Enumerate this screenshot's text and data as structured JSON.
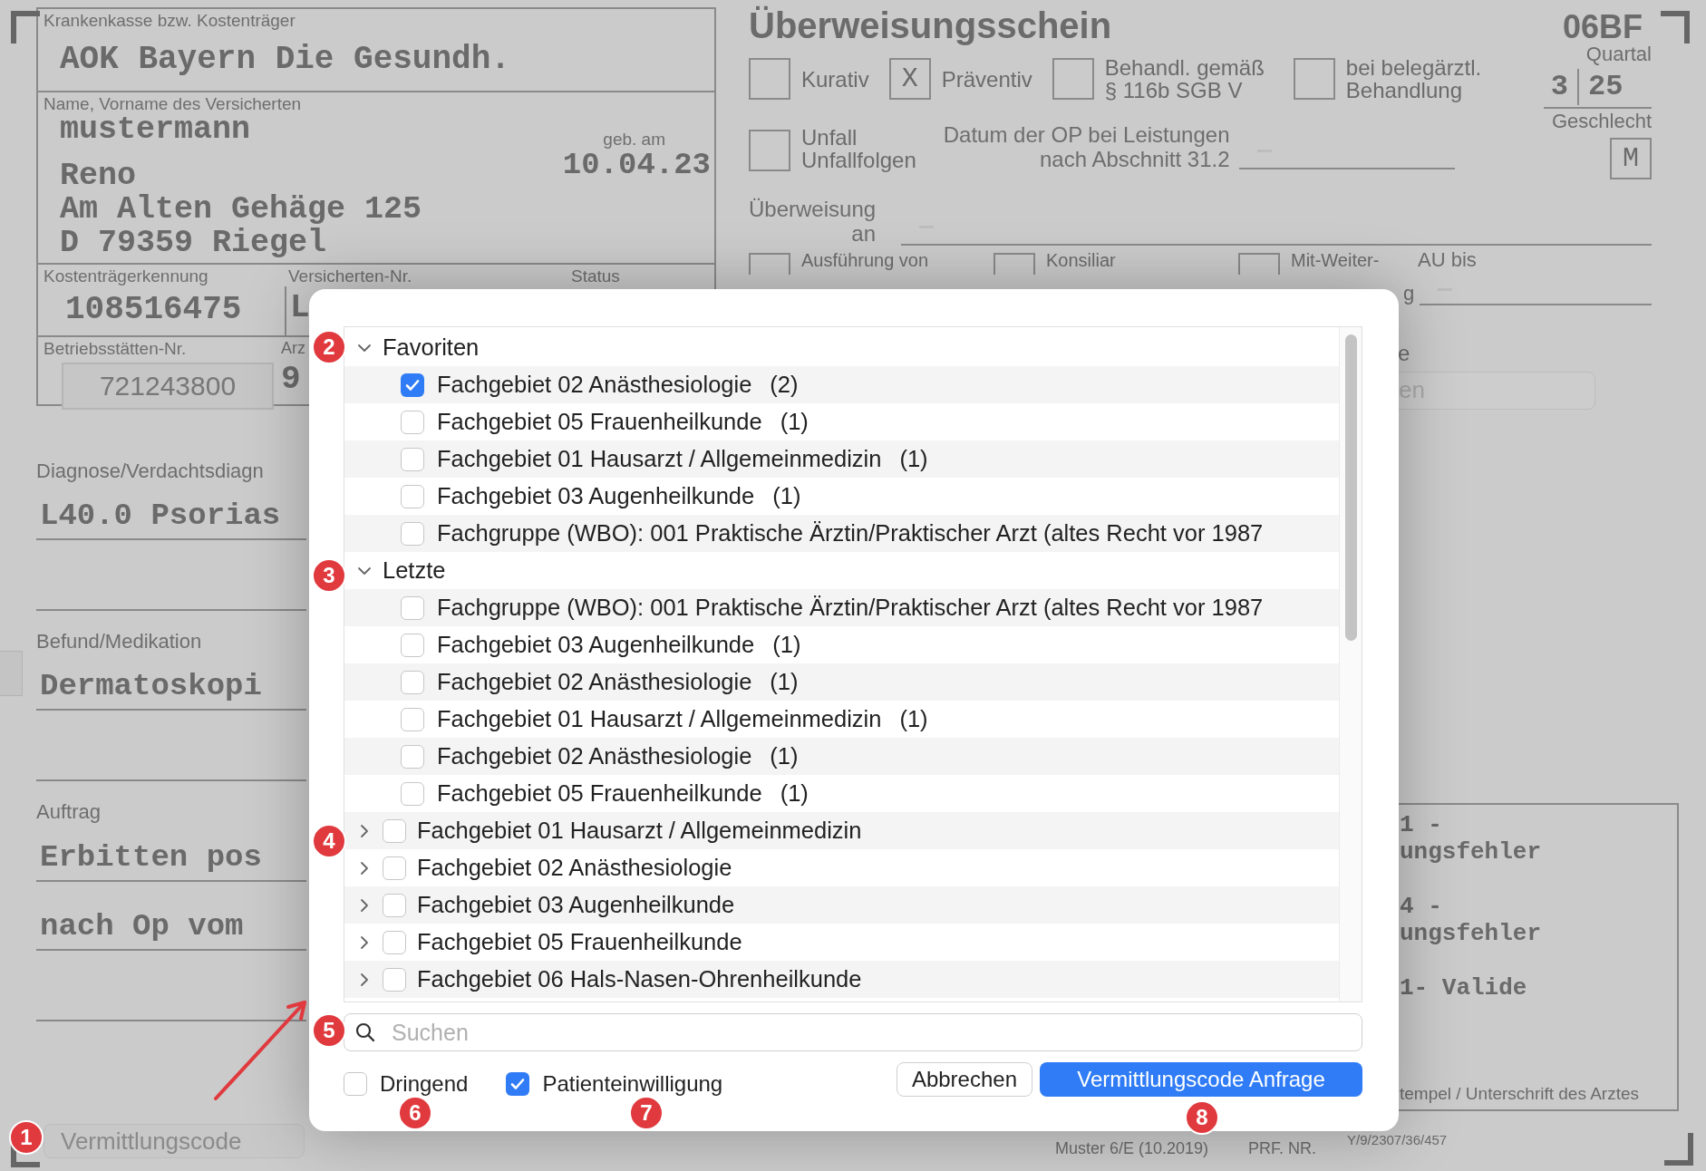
{
  "form": {
    "kasse": {
      "label": "Krankenkasse bzw. Kostenträger",
      "value": "AOK Bayern Die Gesundh."
    },
    "patient": {
      "label": "Name, Vorname des Versicherten",
      "lines": [
        "mustermann",
        "Reno",
        "Am Alten Gehäge 125",
        "D 79359 Riegel"
      ],
      "dob_label": "geb. am",
      "dob": "10.04.23"
    },
    "ids": [
      {
        "label": "Kostenträgerkennung",
        "value": "108516475"
      },
      {
        "label": "Versicherten-Nr.",
        "value": "L"
      },
      {
        "label": "Status"
      }
    ],
    "bsnr": {
      "label": "Betriebsstätten-Nr.",
      "value": "721243800"
    },
    "lanr": {
      "label": "Arz",
      "value": "9"
    },
    "title": "Überweisungsschein",
    "form_code": "06BF",
    "options": [
      {
        "label": "Kurativ",
        "checked": false
      },
      {
        "label": "Präventiv",
        "checked": true,
        "mark": "X"
      },
      {
        "label": "Behandl. gemäß\n§ 116b SGB V",
        "checked": false
      },
      {
        "label": "bei belegärztl.\nBehandlung",
        "checked": false
      }
    ],
    "quartal": {
      "label": "Quartal",
      "values": [
        "3",
        "25"
      ]
    },
    "gender": {
      "label": "Geschlecht",
      "value": "M"
    },
    "unfall": {
      "label": "Unfall\nUnfallfolgen",
      "checked": false
    },
    "op_date": {
      "label": "Datum der OP bei Leistungen\nnach Abschnitt 31.2"
    },
    "referral": {
      "label": "Überweisung\nan"
    },
    "types": [
      {
        "label": "Ausführung von",
        "checked": false
      },
      {
        "label": "Konsiliar",
        "checked": false
      },
      {
        "label": "Mit-Weiter-",
        "checked": false
      }
    ],
    "au": {
      "label": "AU bis",
      "tail": "g"
    },
    "side_label": "e",
    "side_field": "en",
    "sections": [
      {
        "label": "Diagnose/Verdachtsdiagn",
        "lines": [
          "L40.0 Psorias"
        ]
      },
      {
        "label": "Befund/Medikation",
        "lines": [
          "Dermatoskopi"
        ]
      },
      {
        "label": "Auftrag",
        "lines": [
          "Erbitten pos",
          "nach Op vom"
        ]
      }
    ],
    "stamp": {
      "blocks": [
        [
          "1 -",
          "ungsfehler"
        ],
        [
          "4 -",
          "ungsfehler"
        ],
        [
          "1- Valide"
        ]
      ],
      "caption": "tempel / Unterschrift des Arztes"
    },
    "code_button": {
      "label": "Vermittlungscode",
      "disabled": true
    },
    "footer": {
      "form_name": "Muster 6/E (10.2019)",
      "prf": "PRF. NR.",
      "code": "Y/9/2307/36/457"
    }
  },
  "dialog": {
    "tree": [
      {
        "kind": "group",
        "label": "Favoriten",
        "expanded": true,
        "children": [
          {
            "kind": "item",
            "label": "Fachgebiet 02 Anästhesiologie",
            "count": "(2)",
            "checked": true
          },
          {
            "kind": "item",
            "label": "Fachgebiet 05 Frauenheilkunde",
            "count": "(1)",
            "checked": false
          },
          {
            "kind": "item",
            "label": "Fachgebiet 01 Hausarzt / Allgemeinmedizin",
            "count": "(1)",
            "checked": false
          },
          {
            "kind": "item",
            "label": "Fachgebiet 03 Augenheilkunde",
            "count": "(1)",
            "checked": false
          },
          {
            "kind": "item",
            "label": "Fachgruppe (WBO): 001 Praktische Ärztin/Praktischer Arzt (altes Recht vor 1987",
            "checked": false
          }
        ]
      },
      {
        "kind": "group",
        "label": "Letzte",
        "expanded": true,
        "children": [
          {
            "kind": "item",
            "label": "Fachgruppe (WBO): 001 Praktische Ärztin/Praktischer Arzt (altes Recht vor 1987",
            "checked": false
          },
          {
            "kind": "item",
            "label": "Fachgebiet 03 Augenheilkunde",
            "count": "(1)",
            "checked": false
          },
          {
            "kind": "item",
            "label": "Fachgebiet 02 Anästhesiologie",
            "count": "(1)",
            "checked": false
          },
          {
            "kind": "item",
            "label": "Fachgebiet 01 Hausarzt / Allgemeinmedizin",
            "count": "(1)",
            "checked": false
          },
          {
            "kind": "item",
            "label": "Fachgebiet 02 Anästhesiologie",
            "count": "(1)",
            "checked": false
          },
          {
            "kind": "item",
            "label": "Fachgebiet 05 Frauenheilkunde",
            "count": "(1)",
            "checked": false
          }
        ]
      },
      {
        "kind": "branch",
        "label": "Fachgebiet 01 Hausarzt / Allgemeinmedizin",
        "expanded": false,
        "checked": false
      },
      {
        "kind": "branch",
        "label": "Fachgebiet 02 Anästhesiologie",
        "expanded": false,
        "checked": false
      },
      {
        "kind": "branch",
        "label": "Fachgebiet 03 Augenheilkunde",
        "expanded": false,
        "checked": false
      },
      {
        "kind": "branch",
        "label": "Fachgebiet 05 Frauenheilkunde",
        "expanded": false,
        "checked": false
      },
      {
        "kind": "branch",
        "label": "Fachgebiet 06 Hals-Nasen-Ohrenheilkunde",
        "expanded": false,
        "checked": false
      }
    ],
    "search": {
      "placeholder": "Suchen"
    },
    "options": [
      {
        "label": "Dringend",
        "checked": false
      },
      {
        "label": "Patienteinwilligung",
        "checked": true
      }
    ],
    "buttons": [
      {
        "label": "Abbrechen",
        "kind": "secondary"
      },
      {
        "label": "Vermittlungscode Anfrage",
        "kind": "primary"
      }
    ]
  },
  "annotations": [
    "1",
    "2",
    "3",
    "4",
    "5",
    "6",
    "7",
    "8"
  ]
}
